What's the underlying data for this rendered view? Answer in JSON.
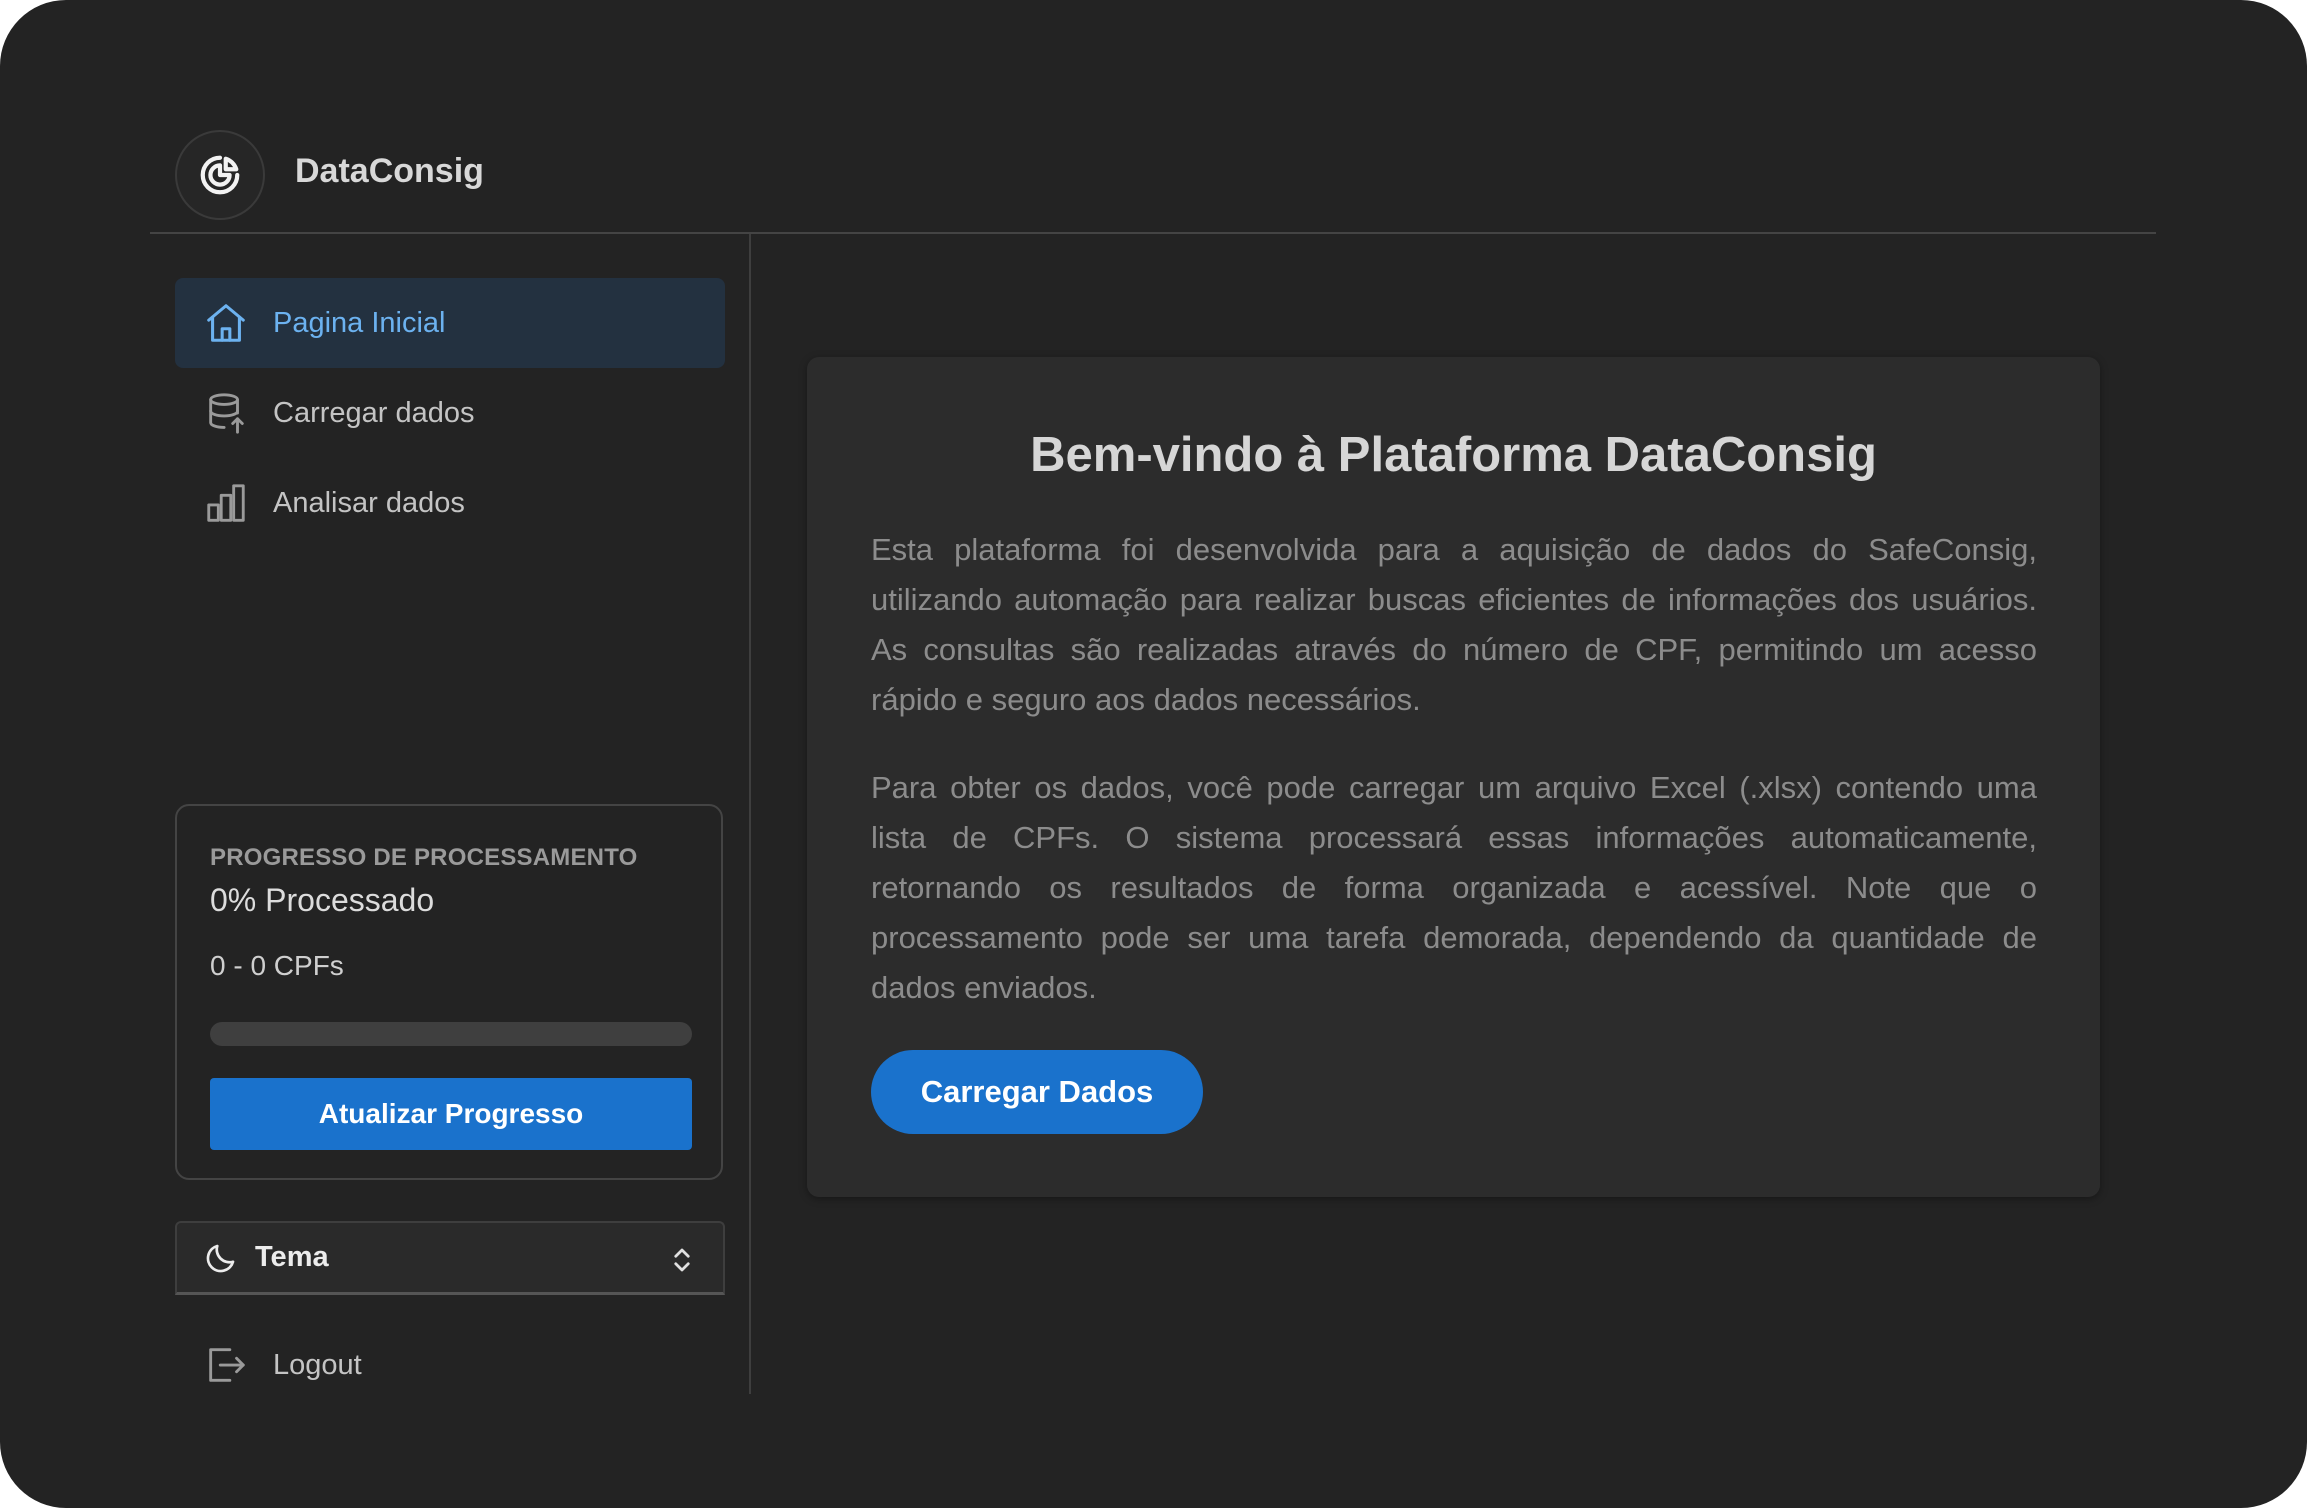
{
  "app": {
    "title": "DataConsig",
    "logo_icon": "pie-chart-icon"
  },
  "sidebar": {
    "items": [
      {
        "label": "Pagina Inicial",
        "icon": "home-icon",
        "active": true
      },
      {
        "label": "Carregar dados",
        "icon": "database-upload-icon",
        "active": false
      },
      {
        "label": "Analisar dados",
        "icon": "bar-chart-icon",
        "active": false
      }
    ],
    "progress": {
      "title": "PROGRESSO DE PROCESSAMENTO",
      "percent_label": "0% Processado",
      "range_label": "0 - 0 CPFs",
      "fraction": 0,
      "button_label": "Atualizar Progresso"
    },
    "theme": {
      "label": "Tema",
      "icon": "moon-icon"
    },
    "logout": {
      "label": "Logout",
      "icon": "logout-icon"
    }
  },
  "main": {
    "title": "Bem-vindo à Plataforma DataConsig",
    "paragraph1": "Esta plataforma foi desenvolvida para a aquisição de dados do SafeConsig, utilizando automação para realizar buscas eficientes de informações dos usuários. As consultas são realizadas através do número de CPF, permitindo um acesso rápido e seguro aos dados necessários.",
    "paragraph2": "Para obter os dados, você pode carregar um arquivo Excel (.xlsx) contendo uma lista de CPFs. O sistema processará essas informações automaticamente, retornando os resultados de forma organizada e acessível. Note que o processamento pode ser uma tarefa demorada, dependendo da quantidade de dados enviados.",
    "cta_label": "Carregar Dados"
  },
  "colors": {
    "background": "#232323",
    "card": "#2c2c2c",
    "accent": "#1a72cc",
    "active_nav_bg": "#233140",
    "active_nav_text": "#6cb2f0"
  }
}
